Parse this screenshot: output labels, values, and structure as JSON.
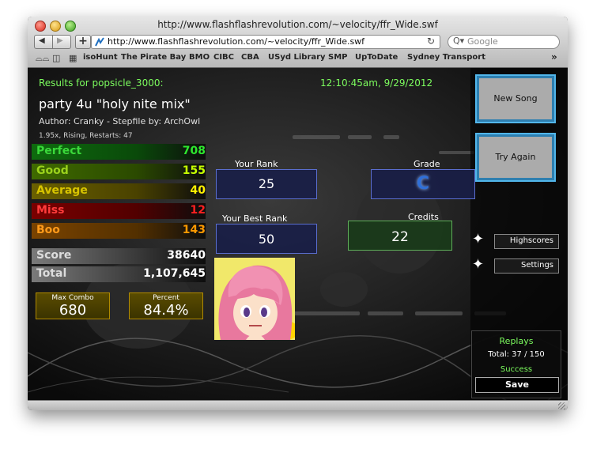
{
  "window": {
    "title": "http://www.flashflashrevolution.com/~velocity/ffr_Wide.swf"
  },
  "toolbar": {
    "back": "◀",
    "forward": "▶",
    "add": "+",
    "url": "http://www.flashflashrevolution.com/~velocity/ffr_Wide.swf",
    "reload": "ͨ",
    "search_icon": "Q▾",
    "search_placeholder": "Google"
  },
  "bookmarks": {
    "icons": [
      "glasses-icon",
      "book-icon",
      "grid-icon"
    ],
    "items": [
      "isoHunt",
      "The Pirate Bay",
      "BMO",
      "CIBC",
      "CBA",
      "USyd Library",
      "SMP",
      "UpToDate",
      "Sydney Transport"
    ],
    "overflow": "»"
  },
  "game": {
    "results_for": "Results for popsicle_3000:",
    "timestamp": "12:10:45am, 9/29/2012",
    "song_title": "party 4u \"holy nite mix\"",
    "author_line": "Author: Cranky  -  Stepfile by: ArchOwl",
    "settings_line": "1.95x, Rising, Restarts: 47",
    "judgements": [
      {
        "label": "Perfect",
        "value": "708",
        "color": "#1db51d"
      },
      {
        "label": "Good",
        "value": "155",
        "color": "#96e000"
      },
      {
        "label": "Average",
        "value": "40",
        "color": "#ffe600"
      },
      {
        "label": "Miss",
        "value": "12",
        "color": "#ff1a1a"
      },
      {
        "label": "Boo",
        "value": "143",
        "color": "#ff8c00"
      }
    ],
    "score_label": "Score",
    "score_value": "38640",
    "total_label": "Total",
    "total_value": "1,107,645",
    "max_combo_label": "Max Combo",
    "max_combo_value": "680",
    "percent_label": "Percent",
    "percent_value": "84.4%",
    "your_rank_label": "Your Rank",
    "your_rank_value": "25",
    "best_rank_label": "Your Best Rank",
    "best_rank_value": "50",
    "grade_label": "Grade",
    "grade_value": "C",
    "credits_label": "Credits",
    "credits_value": "22",
    "new_song": "New Song",
    "try_again": "Try Again",
    "highscores": "Highscores",
    "settings": "Settings",
    "replays_title": "Replays",
    "replays_total": "Total: 37 / 150",
    "replays_status": "Success",
    "save": "Save"
  }
}
